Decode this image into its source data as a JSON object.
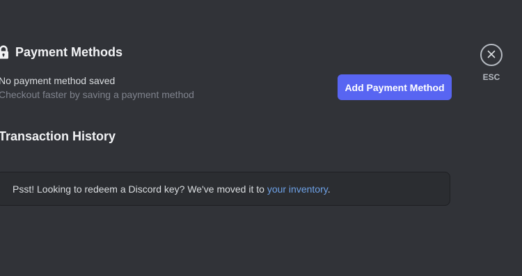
{
  "payment_methods": {
    "title": "Payment Methods",
    "icon": "lock-icon",
    "empty_title": "No payment method saved",
    "empty_subtitle": "Checkout faster by saving a payment method",
    "add_button_label": "Add Payment Method"
  },
  "transaction_history": {
    "title": "Transaction History"
  },
  "notice": {
    "text_before": "Psst! Looking to redeem a Discord key? We've moved it to ",
    "link_text": "your inventory",
    "text_after": "."
  },
  "close": {
    "icon": "close-icon",
    "label": "ESC"
  },
  "colors": {
    "background": "#313338",
    "accent": "#5865f2",
    "link": "#6ea2e8"
  }
}
